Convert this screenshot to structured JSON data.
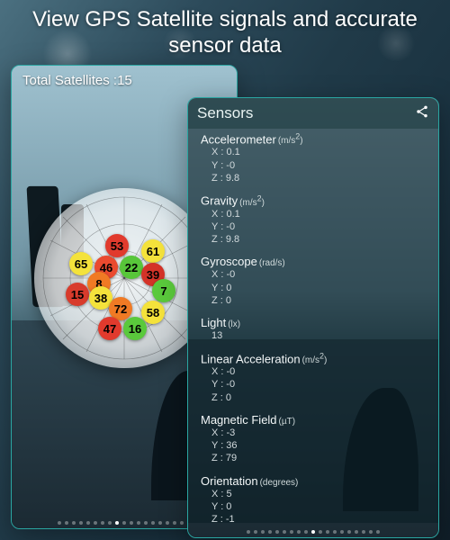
{
  "headline": "View GPS Satellite signals and accurate sensor data",
  "satellites": {
    "label_prefix": "Total Satellites :",
    "count": 15,
    "points": [
      {
        "id": 65,
        "color": "#f4e23b",
        "x": 26,
        "y": 42
      },
      {
        "id": 53,
        "color": "#e13a2d",
        "x": 46,
        "y": 32
      },
      {
        "id": 61,
        "color": "#f4e23b",
        "x": 66,
        "y": 35
      },
      {
        "id": 46,
        "color": "#ea4a2f",
        "x": 40,
        "y": 44
      },
      {
        "id": 22,
        "color": "#58c63a",
        "x": 54,
        "y": 44
      },
      {
        "id": 39,
        "color": "#d43328",
        "x": 66,
        "y": 48
      },
      {
        "id": 8,
        "color": "#f07a24",
        "x": 36,
        "y": 53
      },
      {
        "id": 15,
        "color": "#d83b2c",
        "x": 24,
        "y": 59
      },
      {
        "id": 38,
        "color": "#f4e23b",
        "x": 37,
        "y": 61
      },
      {
        "id": 7,
        "color": "#5ac93c",
        "x": 72,
        "y": 57
      },
      {
        "id": 72,
        "color": "#f07a24",
        "x": 48,
        "y": 67
      },
      {
        "id": 58,
        "color": "#f4e23b",
        "x": 66,
        "y": 69
      },
      {
        "id": 47,
        "color": "#e13a2d",
        "x": 42,
        "y": 78
      },
      {
        "id": 16,
        "color": "#5ac93c",
        "x": 56,
        "y": 78
      }
    ]
  },
  "paging": {
    "left": {
      "total": 19,
      "current": 8
    },
    "right": {
      "total": 19,
      "current": 9
    }
  },
  "sensors_title": "Sensors",
  "sensors": [
    {
      "name": "Accelerometer",
      "unit_html": "(m/s²)",
      "axes": {
        "X": "0.1",
        "Y": "-0",
        "Z": "9.8"
      }
    },
    {
      "name": "Gravity",
      "unit_html": "(m/s²)",
      "axes": {
        "X": "0.1",
        "Y": "-0",
        "Z": "9.8"
      }
    },
    {
      "name": "Gyroscope",
      "unit_html": "(rad/s)",
      "axes": {
        "X": "-0",
        "Y": "0",
        "Z": "0"
      }
    },
    {
      "name": "Light",
      "unit_html": "(lx)",
      "value": "13"
    },
    {
      "name": "Linear Acceleration",
      "unit_html": "(m/s²)",
      "axes": {
        "X": "-0",
        "Y": "-0",
        "Z": "0"
      }
    },
    {
      "name": "Magnetic Field",
      "unit_html": "(µT)",
      "axes": {
        "X": "-3",
        "Y": "36",
        "Z": "79"
      }
    },
    {
      "name": "Orientation",
      "unit_html": "(degrees)",
      "axes": {
        "X": "5",
        "Y": "0",
        "Z": "-1"
      }
    }
  ]
}
